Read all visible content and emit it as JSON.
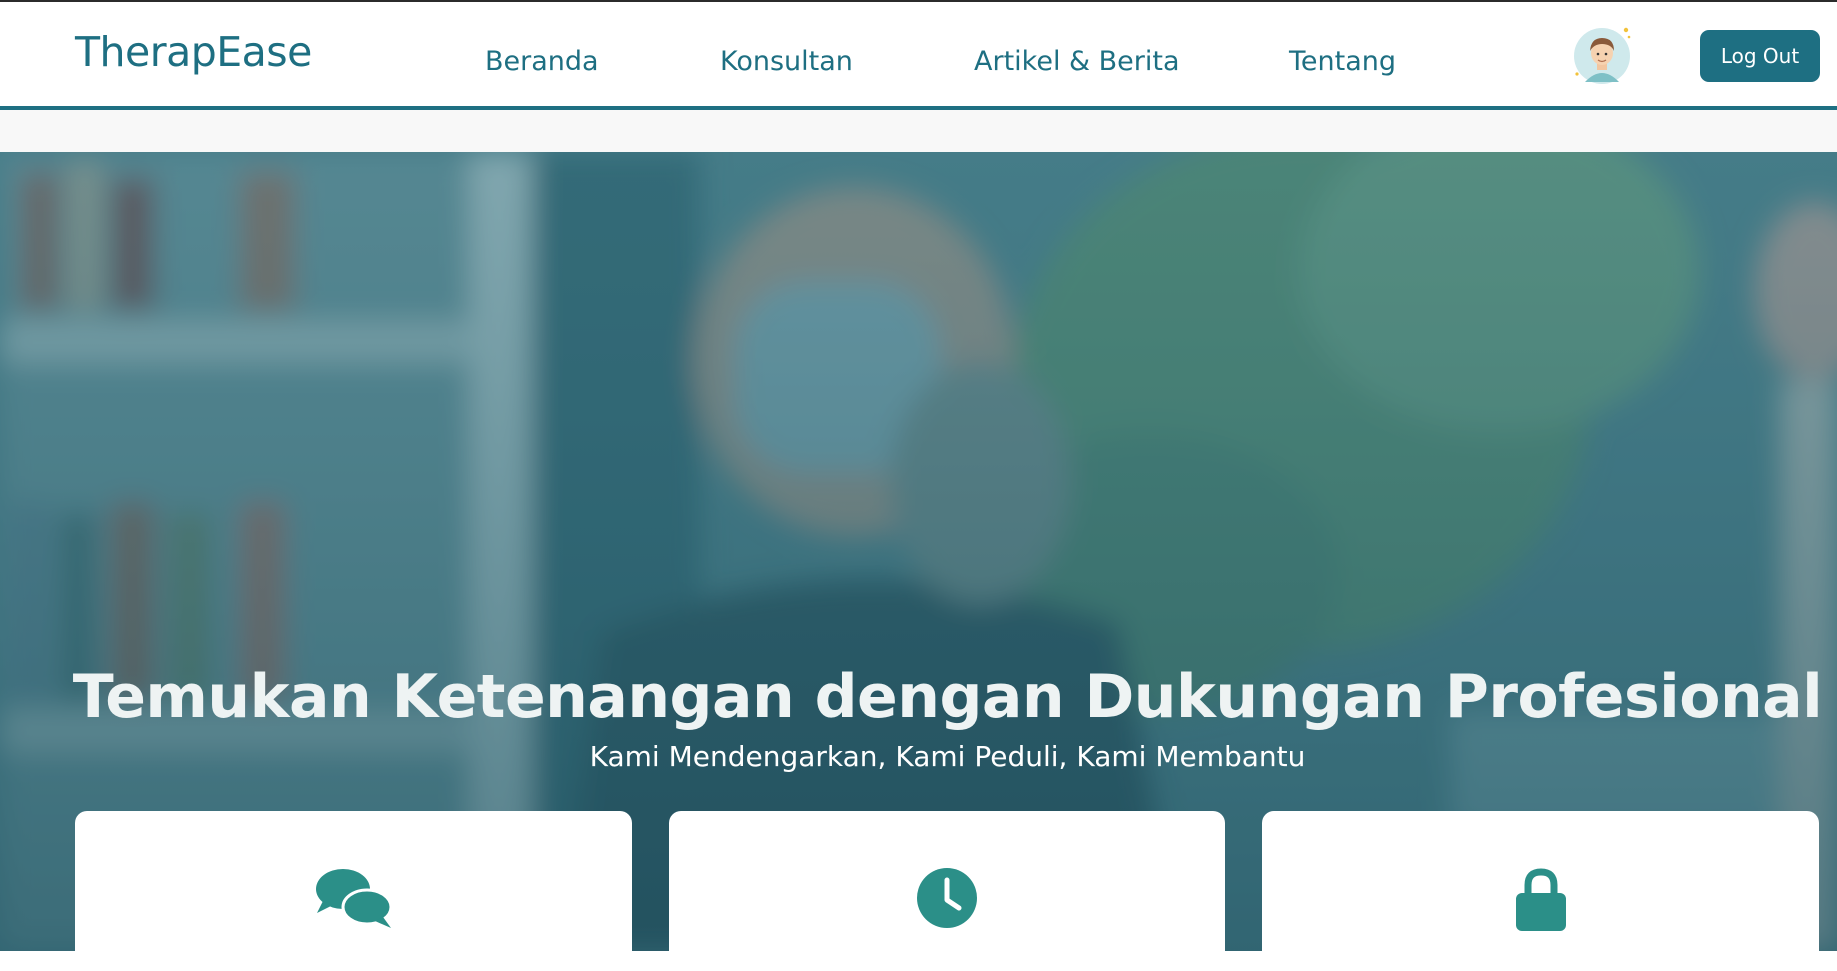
{
  "brand": {
    "name": "TherapEase"
  },
  "nav": {
    "links": [
      {
        "label": "Beranda"
      },
      {
        "label": "Konsultan"
      },
      {
        "label": "Artikel & Berita"
      },
      {
        "label": "Tentang"
      }
    ],
    "logout_label": "Log Out"
  },
  "hero": {
    "title": "Temukan Ketenangan dengan Dukungan Profesional",
    "subtitle": "Kami Mendengarkan, Kami Peduli, Kami Membantu"
  },
  "features": [
    {
      "icon": "chat-bubbles-icon"
    },
    {
      "icon": "clock-icon"
    },
    {
      "icon": "lock-icon"
    }
  ],
  "colors": {
    "primary": "#1e6f82",
    "icon_teal": "#2b8f88",
    "hero_overlay": "#2e6b78"
  }
}
